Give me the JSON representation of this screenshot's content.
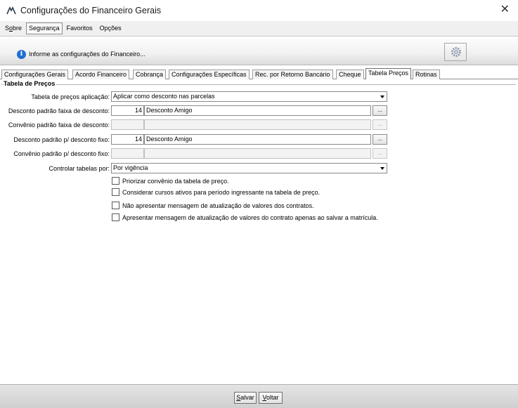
{
  "window": {
    "title": "Configurações do Financeiro Gerais",
    "close_label": "✕"
  },
  "menu": [
    {
      "prefix": "S",
      "underline": "o",
      "suffix": "bre",
      "active": false
    },
    {
      "prefix": "",
      "underline": "",
      "suffix": "Segurança",
      "active": true
    },
    {
      "prefix": "",
      "underline": "",
      "suffix": "Favoritos",
      "active": false
    },
    {
      "prefix": "",
      "underline": "",
      "suffix": "Opções",
      "active": false
    }
  ],
  "info": {
    "icon": "info-icon",
    "text": "Informe as configurações do Financeiro..."
  },
  "tabs": [
    "Configurações Gerais",
    "Acordo Financeiro",
    "Cobrança",
    "Configurações Específicas",
    "Rec. por Retorno Bancário",
    "Cheque",
    "Tabela Preços",
    "Rotinas"
  ],
  "active_tab": "Tabela Preços",
  "group": {
    "title": "Tabela de Preços"
  },
  "fields": {
    "tabela_aplicacao": {
      "label": "Tabela de preços aplicação:",
      "value": "Aplicar como desconto nas parcelas"
    },
    "desconto_faixa": {
      "label": "Desconto padrão faixa de desconto:",
      "code": "14",
      "name": "Desconto Amigo"
    },
    "convenio_faixa": {
      "label": "Convênio padrão faixa de desconto:",
      "code": "",
      "name": ""
    },
    "desconto_fixo": {
      "label": "Desconto padrão p/ desconto fixo:",
      "code": "14",
      "name": "Desconto Amigo"
    },
    "convenio_fixo": {
      "label": "Convênio padrão p/ desconto fixo:",
      "code": "",
      "name": ""
    },
    "controlar": {
      "label": "Controlar tabelas por:",
      "value": "Por vigência"
    },
    "ellipsis_label": "..."
  },
  "checkboxes": [
    {
      "label": "Priorizar convênio da tabela de preço.",
      "checked": false
    },
    {
      "label": "Considerar cursos ativos para período ingressante na tabela de preço.",
      "checked": false
    },
    {
      "label": "Não apresentar mensagem de atualização de valores dos contratos.",
      "checked": false
    },
    {
      "label": "Apresentar mensagem de atualização de valores do contrato apenas ao salvar a matrícula.",
      "checked": false
    }
  ],
  "buttons": {
    "save": {
      "underline": "S",
      "rest": "alvar"
    },
    "back": {
      "underline": "V",
      "rest": "oltar"
    }
  }
}
